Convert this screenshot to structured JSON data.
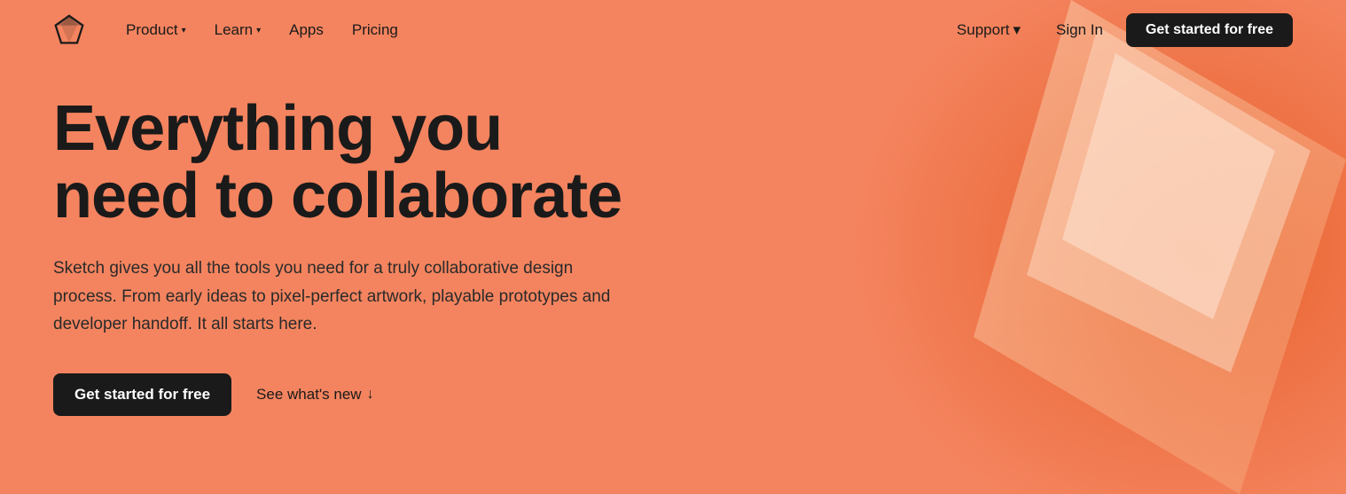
{
  "brand": {
    "logo_alt": "Sketch logo"
  },
  "navbar": {
    "product_label": "Product",
    "learn_label": "Learn",
    "apps_label": "Apps",
    "pricing_label": "Pricing",
    "support_label": "Support",
    "sign_in_label": "Sign In",
    "cta_label": "Get started for free"
  },
  "hero": {
    "title": "Everything you need to collaborate",
    "subtitle": "Sketch gives you all the tools you need for a truly collaborative design process. From early ideas to pixel-perfect artwork, playable prototypes and developer handoff. It all starts here.",
    "cta_primary": "Get started for free",
    "cta_secondary": "See what's new",
    "cta_secondary_arrow": "↓"
  },
  "colors": {
    "background": "#f4845f",
    "dark": "#1a1a1a",
    "white": "#ffffff"
  }
}
